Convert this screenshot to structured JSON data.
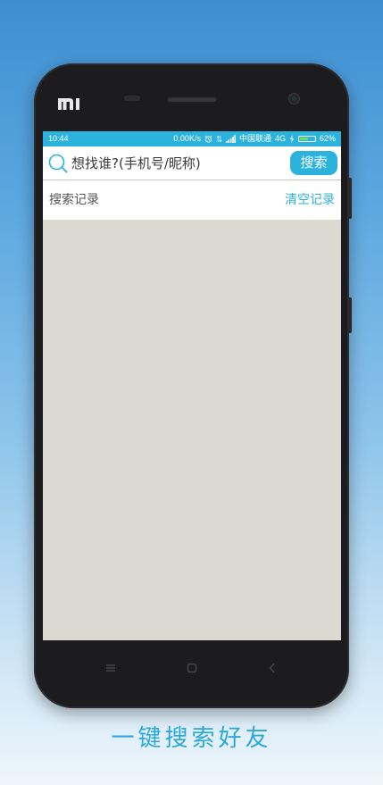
{
  "status_bar": {
    "time": "10:44",
    "net_speed": "0.00K/s",
    "carrier": "中国联通",
    "network": "4G",
    "battery_percent": "62%",
    "battery_level": 0.62
  },
  "search": {
    "placeholder": "想找谁?(手机号/昵称)",
    "value": "",
    "button_label": "搜索"
  },
  "history": {
    "title": "搜索记录",
    "clear_label": "清空记录",
    "items": []
  },
  "caption": "一键搜索好友",
  "colors": {
    "accent": "#2bb3de",
    "list_bg": "#dbdad2",
    "caption": "#2aa7dc"
  },
  "icons": {
    "search": "search-icon",
    "alarm": "alarm-icon",
    "signal": "signal-icon",
    "charging": "charging-icon",
    "battery": "battery-icon",
    "menu": "menu-icon",
    "home": "home-icon",
    "back": "back-icon"
  }
}
